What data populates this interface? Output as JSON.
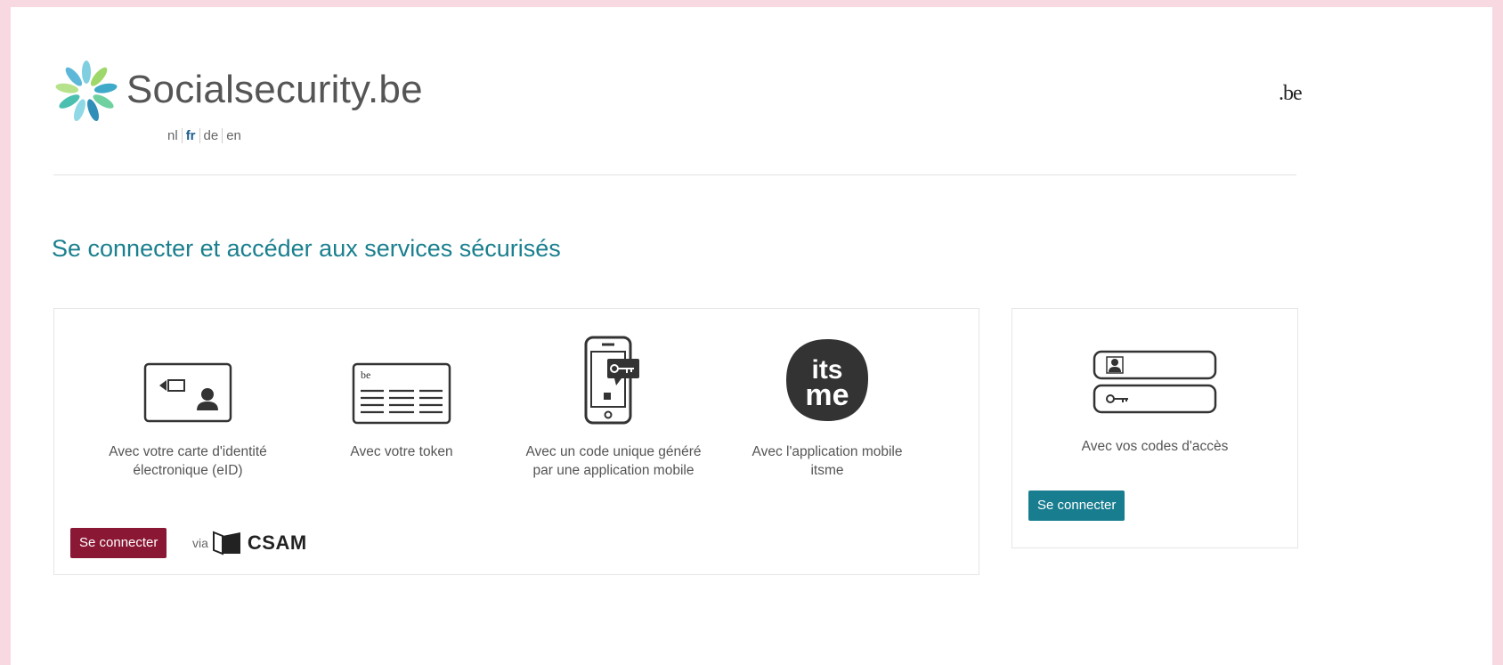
{
  "header": {
    "site_name": "Socialsecurity.be",
    "languages": [
      "nl",
      "fr",
      "de",
      "en"
    ],
    "active_language": "fr",
    "be_mark": ".be"
  },
  "main": {
    "title": "Se connecter et accéder aux services sécurisés",
    "options": [
      {
        "icon": "eid-card-icon",
        "label": "Avec votre carte d'identité électronique (eID)"
      },
      {
        "icon": "token-icon",
        "label": "Avec votre token"
      },
      {
        "icon": "mobile-code-icon",
        "label": "Avec un code unique généré par une application mobile"
      },
      {
        "icon": "itsme-icon",
        "label": "Avec l'application mobile itsme",
        "icon_text_top": "its",
        "icon_text_bottom": "me"
      }
    ],
    "login_button": "Se connecter",
    "via_text": "via",
    "csam_text": "CSAM",
    "token_icon_text": "be"
  },
  "side": {
    "icon": "access-codes-icon",
    "label": "Avec vos codes d'accès",
    "login_button": "Se connecter"
  },
  "colors": {
    "teal": "#1a7f8e",
    "burgundy": "#8a1733",
    "frame": "#f9d9e1"
  }
}
